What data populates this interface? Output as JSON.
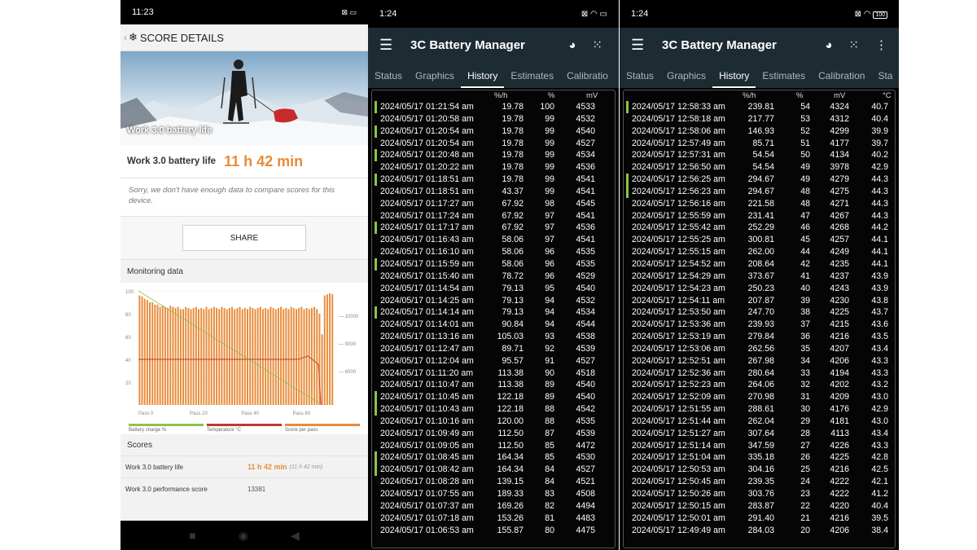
{
  "phone1": {
    "status_time": "11:23",
    "header_title": "SCORE DETAILS",
    "hero_caption": "Work 3.0 battery life",
    "battery_label": "Work 3.0 battery life",
    "battery_value": "11 h 42 min",
    "sorry_text": "Sorry, we don't have enough data to compare scores for this device.",
    "share_label": "SHARE",
    "monitoring_title": "Monitoring data",
    "legend": [
      "Battery charge %",
      "Temperature °C",
      "Score per pass"
    ],
    "legend_colors": [
      "#8bc34a",
      "#c0392b",
      "#e88b3a"
    ],
    "scores_title": "Scores",
    "scores": [
      {
        "name": "Work 3.0 battery life",
        "value": "11 h 42 min",
        "sub": "(11 h 42 min)"
      },
      {
        "name": "Work 3.0 performance score",
        "value": "13381",
        "sub": ""
      }
    ],
    "chart_data": {
      "type": "bar",
      "y_left_ticks": [
        "100",
        "80",
        "60",
        "40",
        "20"
      ],
      "y_right_ticks": [
        "10000",
        "8000",
        "6000"
      ],
      "x_ticks": [
        "Pass 0",
        "Pass 20",
        "Pass 40",
        "Pass 60"
      ],
      "score_per_pass": [
        96,
        95,
        93,
        92,
        90,
        90,
        88,
        88,
        86,
        87,
        86,
        85,
        87,
        86,
        85,
        86,
        84,
        84,
        86,
        85,
        84,
        85,
        86,
        84,
        85,
        84,
        86,
        84,
        85,
        86,
        85,
        84,
        86,
        85,
        84,
        85,
        86,
        84,
        85,
        86,
        84,
        85,
        84,
        86,
        85,
        84,
        85,
        86,
        84,
        85,
        84,
        86,
        85,
        84,
        85,
        86,
        84,
        85,
        84,
        86,
        85,
        84,
        85,
        86,
        84,
        85,
        84,
        85,
        86,
        84,
        80,
        62,
        96,
        97,
        98,
        97
      ],
      "battery_charge": {
        "start": 100,
        "end": 2
      },
      "temperature_level": 40
    }
  },
  "app": {
    "title": "3C Battery Manager",
    "tabs": [
      "Status",
      "Graphics",
      "History",
      "Estimates",
      "Calibratio",
      "Calibration",
      "Sta"
    ],
    "active_tab": "History",
    "col_headers": [
      "%/h",
      "%",
      "mV",
      "°C"
    ]
  },
  "phone2": {
    "status_time": "1:24",
    "rows": [
      [
        "2024/05/17 01:21:54 am",
        "19.78",
        "100",
        "4533"
      ],
      [
        "2024/05/17 01:20:58 am",
        "19.78",
        "99",
        "4532"
      ],
      [
        "2024/05/17 01:20:54 am",
        "19.78",
        "99",
        "4540"
      ],
      [
        "2024/05/17 01:20:54 am",
        "19.78",
        "99",
        "4527"
      ],
      [
        "2024/05/17 01:20:48 am",
        "19.78",
        "99",
        "4534"
      ],
      [
        "2024/05/17 01:20:22 am",
        "19.78",
        "99",
        "4536"
      ],
      [
        "2024/05/17 01:18:51 am",
        "19.78",
        "99",
        "4541"
      ],
      [
        "2024/05/17 01:18:51 am",
        "43.37",
        "99",
        "4541"
      ],
      [
        "2024/05/17 01:17:27 am",
        "67.92",
        "98",
        "4545"
      ],
      [
        "2024/05/17 01:17:24 am",
        "67.92",
        "97",
        "4541"
      ],
      [
        "2024/05/17 01:17:17 am",
        "67.92",
        "97",
        "4536"
      ],
      [
        "2024/05/17 01:16:43 am",
        "58.06",
        "97",
        "4541"
      ],
      [
        "2024/05/17 01:16:10 am",
        "58.06",
        "96",
        "4535"
      ],
      [
        "2024/05/17 01:15:59 am",
        "58.06",
        "96",
        "4535"
      ],
      [
        "2024/05/17 01:15:40 am",
        "78.72",
        "96",
        "4529"
      ],
      [
        "2024/05/17 01:14:54 am",
        "79.13",
        "95",
        "4540"
      ],
      [
        "2024/05/17 01:14:25 am",
        "79.13",
        "94",
        "4532"
      ],
      [
        "2024/05/17 01:14:14 am",
        "79.13",
        "94",
        "4534"
      ],
      [
        "2024/05/17 01:14:01 am",
        "90.84",
        "94",
        "4544"
      ],
      [
        "2024/05/17 01:13:16 am",
        "105.03",
        "93",
        "4538"
      ],
      [
        "2024/05/17 01:12:47 am",
        "89.71",
        "92",
        "4539"
      ],
      [
        "2024/05/17 01:12:04 am",
        "95.57",
        "91",
        "4527"
      ],
      [
        "2024/05/17 01:11:20 am",
        "113.38",
        "90",
        "4518"
      ],
      [
        "2024/05/17 01:10:47 am",
        "113.38",
        "89",
        "4540"
      ],
      [
        "2024/05/17 01:10:45 am",
        "122.18",
        "89",
        "4540"
      ],
      [
        "2024/05/17 01:10:43 am",
        "122.18",
        "88",
        "4542"
      ],
      [
        "2024/05/17 01:10:16 am",
        "120.00",
        "88",
        "4535"
      ],
      [
        "2024/05/17 01:09:49 am",
        "112.50",
        "87",
        "4539"
      ],
      [
        "2024/05/17 01:09:05 am",
        "112.50",
        "85",
        "4472"
      ],
      [
        "2024/05/17 01:08:45 am",
        "164.34",
        "85",
        "4530"
      ],
      [
        "2024/05/17 01:08:42 am",
        "164.34",
        "84",
        "4527"
      ],
      [
        "2024/05/17 01:08:28 am",
        "139.15",
        "84",
        "4521"
      ],
      [
        "2024/05/17 01:07:55 am",
        "189.33",
        "83",
        "4508"
      ],
      [
        "2024/05/17 01:07:37 am",
        "169.26",
        "82",
        "4494"
      ],
      [
        "2024/05/17 01:07:18 am",
        "153.26",
        "81",
        "4483"
      ],
      [
        "2024/05/17 01:06:53 am",
        "155.87",
        "80",
        "4475"
      ]
    ],
    "marked_rows": [
      0,
      2,
      4,
      6,
      10,
      13,
      17,
      24,
      25,
      29,
      30
    ]
  },
  "phone3": {
    "status_time": "1:24",
    "battery_text": "100",
    "rows": [
      [
        "2024/05/17 12:58:33 am",
        "239.81",
        "54",
        "4324",
        "40.7"
      ],
      [
        "2024/05/17 12:58:18 am",
        "217.77",
        "53",
        "4312",
        "40.4"
      ],
      [
        "2024/05/17 12:58:06 am",
        "146.93",
        "52",
        "4299",
        "39.9"
      ],
      [
        "2024/05/17 12:57:49 am",
        "85.71",
        "51",
        "4177",
        "39.7"
      ],
      [
        "2024/05/17 12:57:31 am",
        "54.54",
        "50",
        "4134",
        "40.2"
      ],
      [
        "2024/05/17 12:56:50 am",
        "54.54",
        "49",
        "3978",
        "42.9"
      ],
      [
        "2024/05/17 12:56:25 am",
        "294.67",
        "49",
        "4279",
        "44.3"
      ],
      [
        "2024/05/17 12:56:23 am",
        "294.67",
        "48",
        "4275",
        "44.3"
      ],
      [
        "2024/05/17 12:56:16 am",
        "221.58",
        "48",
        "4271",
        "44.3"
      ],
      [
        "2024/05/17 12:55:59 am",
        "231.41",
        "47",
        "4267",
        "44.3"
      ],
      [
        "2024/05/17 12:55:42 am",
        "252.29",
        "46",
        "4268",
        "44.2"
      ],
      [
        "2024/05/17 12:55:25 am",
        "300.81",
        "45",
        "4257",
        "44.1"
      ],
      [
        "2024/05/17 12:55:15 am",
        "262.00",
        "44",
        "4249",
        "44.1"
      ],
      [
        "2024/05/17 12:54:52 am",
        "208.64",
        "42",
        "4235",
        "44.1"
      ],
      [
        "2024/05/17 12:54:29 am",
        "373.67",
        "41",
        "4237",
        "43.9"
      ],
      [
        "2024/05/17 12:54:23 am",
        "250.23",
        "40",
        "4243",
        "43.9"
      ],
      [
        "2024/05/17 12:54:11 am",
        "207.87",
        "39",
        "4230",
        "43.8"
      ],
      [
        "2024/05/17 12:53:50 am",
        "247.70",
        "38",
        "4225",
        "43.7"
      ],
      [
        "2024/05/17 12:53:36 am",
        "239.93",
        "37",
        "4215",
        "43.6"
      ],
      [
        "2024/05/17 12:53:19 am",
        "279.84",
        "36",
        "4216",
        "43.5"
      ],
      [
        "2024/05/17 12:53:06 am",
        "262.56",
        "35",
        "4207",
        "43.4"
      ],
      [
        "2024/05/17 12:52:51 am",
        "267.98",
        "34",
        "4206",
        "43.3"
      ],
      [
        "2024/05/17 12:52:36 am",
        "280.64",
        "33",
        "4194",
        "43.3"
      ],
      [
        "2024/05/17 12:52:23 am",
        "264.06",
        "32",
        "4202",
        "43.2"
      ],
      [
        "2024/05/17 12:52:09 am",
        "270.98",
        "31",
        "4209",
        "43.0"
      ],
      [
        "2024/05/17 12:51:55 am",
        "288.61",
        "30",
        "4176",
        "42.9"
      ],
      [
        "2024/05/17 12:51:44 am",
        "262.04",
        "29",
        "4181",
        "43.0"
      ],
      [
        "2024/05/17 12:51:27 am",
        "307.64",
        "28",
        "4113",
        "43.4"
      ],
      [
        "2024/05/17 12:51:14 am",
        "347.59",
        "27",
        "4226",
        "43.3"
      ],
      [
        "2024/05/17 12:51:04 am",
        "335.18",
        "26",
        "4225",
        "42.8"
      ],
      [
        "2024/05/17 12:50:53 am",
        "304.16",
        "25",
        "4216",
        "42.5"
      ],
      [
        "2024/05/17 12:50:45 am",
        "239.35",
        "24",
        "4222",
        "42.1"
      ],
      [
        "2024/05/17 12:50:26 am",
        "303.76",
        "23",
        "4222",
        "41.2"
      ],
      [
        "2024/05/17 12:50:15 am",
        "283.87",
        "22",
        "4220",
        "40.4"
      ],
      [
        "2024/05/17 12:50:01 am",
        "291.40",
        "21",
        "4216",
        "39.5"
      ],
      [
        "2024/05/17 12:49:49 am",
        "284.03",
        "20",
        "4206",
        "38.4"
      ]
    ],
    "marked_rows": [
      0,
      6,
      7
    ]
  }
}
